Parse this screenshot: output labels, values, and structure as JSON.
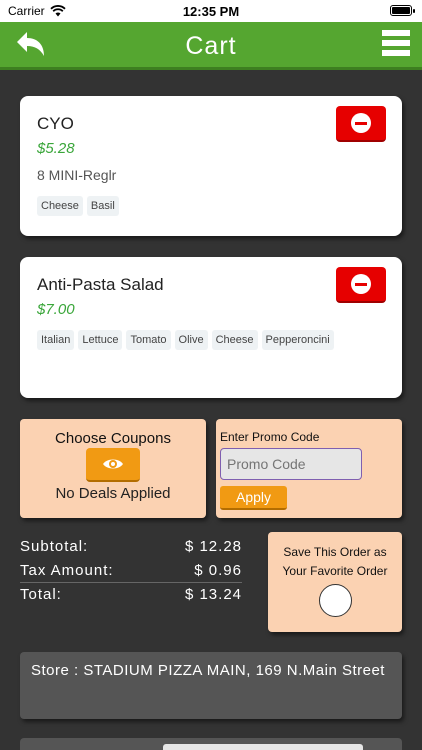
{
  "status_bar": {
    "carrier": "Carrier",
    "time": "12:35 PM"
  },
  "header": {
    "title": "Cart"
  },
  "cart_items": [
    {
      "name": "CYO",
      "price": "$5.28",
      "size": "8 MINI-Reglr",
      "toppings": [
        "Cheese",
        "Basil"
      ]
    },
    {
      "name": "Anti-Pasta Salad",
      "price": "$7.00",
      "toppings": [
        "Italian",
        "Lettuce",
        "Tomato",
        "Olive",
        "Cheese",
        "Pepperoncini"
      ]
    }
  ],
  "coupons": {
    "title": "Choose Coupons",
    "status": "No Deals Applied"
  },
  "promo": {
    "label": "Enter Promo Code",
    "placeholder": "Promo Code",
    "apply_label": "Apply"
  },
  "totals": {
    "subtotal_label": "Subtotal:",
    "subtotal_value": "$ 12.28",
    "tax_label": "Tax Amount:",
    "tax_value": "$ 0.96",
    "total_label": "Total:",
    "total_value": "$ 13.24"
  },
  "favorite": {
    "label": "Save This Order as Your Favorite Order"
  },
  "store": {
    "text": "Store : STADIUM PIZZA MAIN, 169 N.Main Street"
  },
  "colors": {
    "header_green": "#55a630",
    "price_green": "#3aa63a",
    "remove_red": "#e60000",
    "accent_orange": "#f19a13",
    "panel_peach": "#fbd2b2",
    "background": "#333333"
  }
}
